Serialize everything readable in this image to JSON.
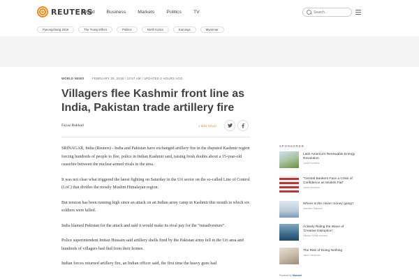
{
  "header": {
    "logo_text": "REUTERS",
    "nav": [
      "World",
      "Business",
      "Markets",
      "Politics",
      "TV"
    ],
    "search_placeholder": "Search..."
  },
  "tags": [
    "Pyeongchang 2018",
    "The Trump Effect",
    "Politics",
    "North Korea",
    "Earnings",
    "Myanmar"
  ],
  "article": {
    "section": "WORLD NEWS",
    "timestamp": "FEBRUARY 25, 2018 / 10:57 AM / UPDATED 2 HOURS AGO",
    "headline": "Villagers flee Kashmir front line as India, Pakistan trade artillery fire",
    "author": "Fayaz Bukhari",
    "read_time": "3 MIN READ",
    "paragraphs": [
      "SRINAGAR, India (Reuters) - India and Pakistan have exchanged artillery fire in the disputed Kashmir region forcing hundreds of people to flee, police in Indian Kashmir said, raising fresh doubts about a 15-year-old ceasefire between the nuclear-armed rivals in the area.",
      "It was not clear what triggered the latest fighting on Saturday in the Uri sector on the so-called Line of Control (LoC) that divides the mostly Muslim Himalayan region.",
      "But tension has been running high since an attack on an Indian army camp in Kashmir this month in which six soldiers were killed.",
      "India blamed Pakistan for the attack and said it would make its rival pay for the “misadventure”.",
      "Police superintendent Imtiaz Hussain said artillery shells fired by the Pakistan army fell in the Uri area and hundreds of villagers had fled from their homes.",
      "Indian forces returned artillery fire, an Indian officer said, the first time the heavy guns had"
    ]
  },
  "sponsored": {
    "heading": "SPONSORED",
    "items": [
      {
        "title": "Latin America's Renewable Energy Revolution",
        "source": "Lazard Investors",
        "color": "#6a8f3c"
      },
      {
        "title": "\"Central Bankers Face a Crisis of Confidence as Models Fail\"",
        "source": "Lazard Investors",
        "color": "#b03a3a"
      },
      {
        "title": "Where is the clever money going?",
        "source": "Aberdeen Standard",
        "color": "#7a9ab5"
      },
      {
        "title": "Actively Riding the Wave of 'Creative Disruption'",
        "source": "Alliance Global Investors",
        "color": "#3d6d8c"
      },
      {
        "title": "The Risk of Doing Nothing",
        "source": "Janus Henderson",
        "color": "#9a8c7a"
      }
    ],
    "powered_by": "Powered by",
    "powered_brand": "Dianomi"
  }
}
